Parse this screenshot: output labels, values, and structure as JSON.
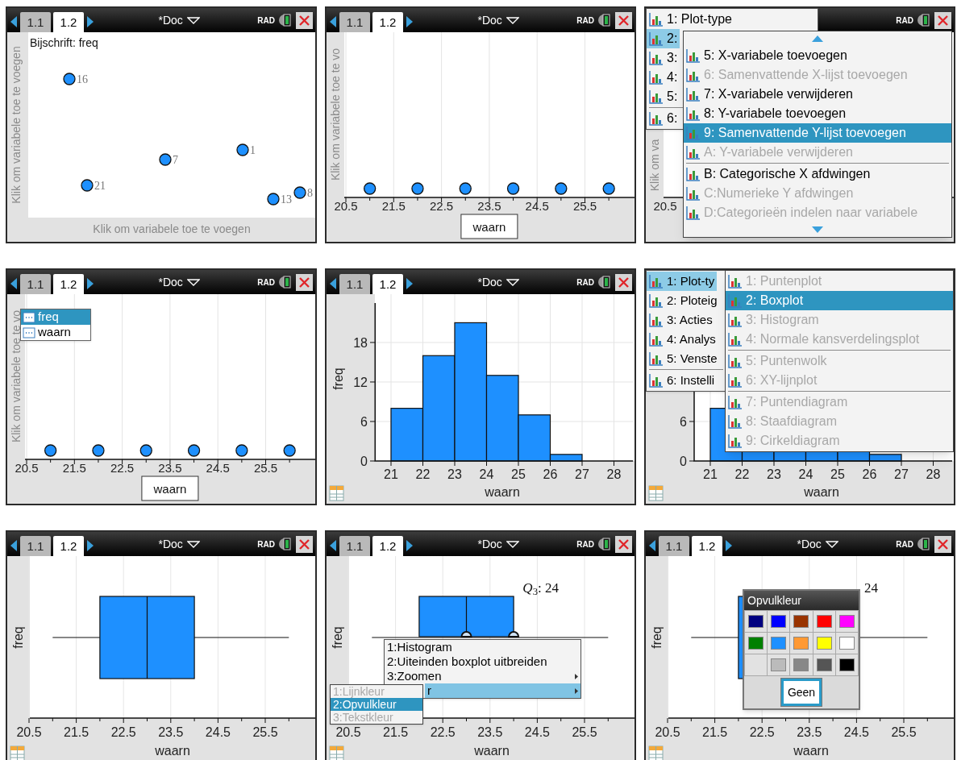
{
  "panels": [
    {
      "kind": "labelled_points",
      "header": {
        "tabs": [
          {
            "label": "1.1",
            "selected": false
          },
          {
            "label": "1.2",
            "selected": true
          }
        ],
        "title": "*Doc",
        "mode": "RAD"
      },
      "caption": "Bijschrift: freq",
      "y_prompt": "Klik om variabele toe te voegen",
      "x_prompt": "Klik om variabele toe te voegen",
      "points": [
        {
          "label": "16"
        },
        {
          "label": "21"
        },
        {
          "label": "7"
        },
        {
          "label": "1"
        },
        {
          "label": "13"
        },
        {
          "label": "8"
        }
      ]
    },
    {
      "kind": "dotplot",
      "header": {
        "tabs": [
          {
            "label": "1.1",
            "selected": false
          },
          {
            "label": "1.2",
            "selected": true
          }
        ],
        "title": "*Doc",
        "mode": "RAD"
      },
      "y_prompt": "Klik om variabele toe te vo",
      "x_label": "waarn",
      "x_ticks": [
        "20.5",
        "21.5",
        "22.5",
        "23.5",
        "24.5",
        "25.5"
      ]
    },
    {
      "kind": "covered_plot",
      "header": {
        "mode": "RAD"
      },
      "y_prompt": "Klik om va",
      "x_tick": "20.5",
      "menu": {
        "groups": [
          [
            {
              "label": "1: Plot-type",
              "selected": false
            },
            {
              "label": "2:",
              "selected": true
            },
            {
              "label": "3:",
              "selected": false
            },
            {
              "label": "4:",
              "selected": false
            },
            {
              "label": "5:",
              "selected": false
            }
          ],
          [
            {
              "label": "6:",
              "selected": false
            }
          ]
        ]
      },
      "submenu": {
        "scrollable": true,
        "groups": [
          [
            {
              "label": "5: X-variabele toevoegen",
              "selected": false,
              "disabled": false
            },
            {
              "label": "6: Samenvattende X-lijst toevoegen",
              "selected": false,
              "disabled": true
            },
            {
              "label": "7: X-variabele verwijderen",
              "selected": false,
              "disabled": false
            },
            {
              "label": "8: Y-variabele toevoegen",
              "selected": false,
              "disabled": false
            },
            {
              "label": "9: Samenvattende Y-lijst toevoegen",
              "selected": true,
              "disabled": false
            },
            {
              "label": "A: Y-variabele verwijderen",
              "selected": false,
              "disabled": true
            }
          ],
          [
            {
              "label": "B: Categorische X afdwingen",
              "selected": false,
              "disabled": false
            },
            {
              "label": "C:Numerieke Y afdwingen",
              "selected": false,
              "disabled": true
            },
            {
              "label": "D:Categorieën indelen naar variabele",
              "selected": false,
              "disabled": true
            }
          ]
        ]
      }
    },
    {
      "kind": "dotplot",
      "header": {
        "tabs": [
          {
            "label": "1.1",
            "selected": false
          },
          {
            "label": "1.2",
            "selected": true
          }
        ],
        "title": "*Doc",
        "mode": "RAD"
      },
      "y_prompt": "Klik om variabele toe te vo",
      "x_label": "waarn",
      "x_ticks": [
        "20.5",
        "21.5",
        "22.5",
        "23.5",
        "24.5",
        "25.5"
      ],
      "variable_list": [
        {
          "label": "freq",
          "selected": true
        },
        {
          "label": "waarn",
          "selected": false
        }
      ]
    },
    {
      "kind": "histogram",
      "header": {
        "tabs": [
          {
            "label": "1.1",
            "selected": false
          },
          {
            "label": "1.2",
            "selected": true
          }
        ],
        "title": "*Doc",
        "mode": "RAD"
      },
      "chart_data": {
        "type": "bar",
        "xlabel": "waarn",
        "ylabel": "freq",
        "x": [
          21.5,
          22.5,
          23.5,
          24.5,
          25.5,
          26.5
        ],
        "values": [
          8,
          16,
          21,
          13,
          7,
          1
        ],
        "xticks": [
          21,
          22,
          23,
          24,
          25,
          26,
          27,
          28
        ],
        "yticks": [
          0,
          6,
          12,
          18
        ],
        "xlim": [
          20.5,
          28.6
        ],
        "ylim": [
          0,
          24
        ],
        "grid": true
      }
    },
    {
      "kind": "covered_histogram",
      "x_label": "waarn",
      "x_ticks": [
        "21",
        "22",
        "23",
        "24",
        "25",
        "26",
        "27",
        "28"
      ],
      "y_ticks": [
        "6",
        "0"
      ],
      "menu": {
        "groups": [
          [
            {
              "label": "1: Plot-ty",
              "selected": true
            },
            {
              "label": "2: Ploteig",
              "selected": false
            },
            {
              "label": "3: Acties",
              "selected": false
            },
            {
              "label": "4: Analys",
              "selected": false
            },
            {
              "label": "5: Venste",
              "selected": false
            }
          ],
          [
            {
              "label": "6: Instelli",
              "selected": false
            }
          ]
        ]
      },
      "submenu": {
        "groups": [
          [
            {
              "label": "1: Puntenplot",
              "selected": false,
              "disabled": true
            },
            {
              "label": "2: Boxplot",
              "selected": true,
              "disabled": false
            },
            {
              "label": "3: Histogram",
              "selected": false,
              "disabled": true
            },
            {
              "label": "4: Normale kansverdelingsplot",
              "selected": false,
              "disabled": true
            }
          ],
          [
            {
              "label": "5: Puntenwolk",
              "selected": false,
              "disabled": true
            },
            {
              "label": "6: XY-lijnplot",
              "selected": false,
              "disabled": true
            }
          ],
          [
            {
              "label": "7: Puntendiagram",
              "selected": false,
              "disabled": true
            },
            {
              "label": "8: Staafdiagram",
              "selected": false,
              "disabled": true
            },
            {
              "label": "9: Cirkeldiagram",
              "selected": false,
              "disabled": true
            }
          ]
        ]
      }
    },
    {
      "kind": "boxplot",
      "header": {
        "tabs": [
          {
            "label": "1.1",
            "selected": false
          },
          {
            "label": "1.2",
            "selected": true
          }
        ],
        "title": "*Doc",
        "mode": "RAD"
      },
      "ylabel": "freq",
      "xlabel": "waarn",
      "x_ticks": [
        "20.5",
        "21.5",
        "22.5",
        "23.5",
        "24.5",
        "25.5"
      ]
    },
    {
      "kind": "boxplot",
      "header": {
        "tabs": [
          {
            "label": "1.1",
            "selected": false
          },
          {
            "label": "1.2",
            "selected": true
          }
        ],
        "title": "*Doc",
        "mode": "RAD"
      },
      "ylabel": "freq",
      "xlabel": "waarn",
      "x_ticks": [
        "20.5",
        "21.5",
        "22.5",
        "23.5",
        "24.5",
        "25.5"
      ],
      "annotation": "*Q*$_{3}$: 24",
      "context_menu": {
        "items": [
          {
            "label": "1:Histogram",
            "selected": false,
            "submenu": false,
            "covered": false
          },
          {
            "label": "2:Uiteinden boxplot uitbreiden",
            "selected": false,
            "submenu": false,
            "covered": false
          },
          {
            "label": "3:Zoomen",
            "selected": false,
            "submenu": true,
            "covered": false
          },
          {
            "label": "r",
            "selected": true,
            "submenu": true,
            "covered": true
          }
        ]
      },
      "color_menu": {
        "groups": [
          [
            {
              "label": "1:Lijnkleur",
              "selected": false,
              "disabled": true
            },
            {
              "label": "2:Opvulkleur",
              "selected": true,
              "disabled": false
            },
            {
              "label": "3:Tekstkleur",
              "selected": false,
              "disabled": true
            }
          ]
        ]
      }
    },
    {
      "kind": "boxplot",
      "header": {
        "tabs": [
          {
            "label": "1.1",
            "selected": false
          },
          {
            "label": "1.2",
            "selected": true
          }
        ],
        "title": "*Doc",
        "mode": "RAD"
      },
      "ylabel": "freq",
      "xlabel": "waarn",
      "x_ticks": [
        "20.5",
        "21.5",
        "22.5",
        "23.5",
        "24.5",
        "25.5"
      ],
      "annotation": "24",
      "dialog": {
        "title": "Opvulkleur",
        "swatches": [
          {
            "kind": "swatch",
            "color": "#000080"
          },
          {
            "kind": "swatch",
            "color": "#0000ff"
          },
          {
            "kind": "swatch",
            "color": "#993300"
          },
          {
            "kind": "swatch",
            "color": "#ff0000"
          },
          {
            "kind": "swatch",
            "color": "#ff00ff"
          },
          {
            "kind": "swatch",
            "color": "#008000"
          },
          {
            "kind": "swatch",
            "color": "#1e90ff"
          },
          {
            "kind": "swatch",
            "color": "#ff9933"
          },
          {
            "kind": "swatch",
            "color": "#ffff00"
          },
          {
            "kind": "swatch",
            "color": "#ffffff"
          },
          {
            "kind": "blank"
          },
          {
            "kind": "swatch",
            "color": "#bbbbbb"
          },
          {
            "kind": "swatch",
            "color": "#888888"
          },
          {
            "kind": "swatch",
            "color": "#555555"
          },
          {
            "kind": "swatch",
            "color": "#000000"
          }
        ],
        "button": "Geen"
      }
    }
  ]
}
